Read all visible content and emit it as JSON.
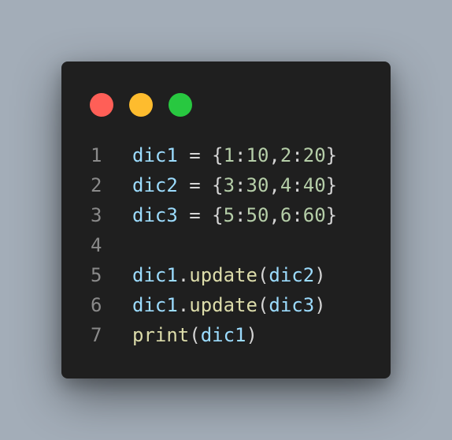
{
  "window": {
    "controls": [
      {
        "name": "close",
        "color": "#ff5f57"
      },
      {
        "name": "minimize",
        "color": "#febc2e"
      },
      {
        "name": "maximize",
        "color": "#28c840"
      }
    ]
  },
  "colors": {
    "background": "#a3adb8",
    "editor_background": "#1f1f1f",
    "line_number": "#8a8a8a",
    "variable": "#9cdcfe",
    "function": "#dcdcaa",
    "number": "#b5cea8",
    "punctuation": "#d4d4d4"
  },
  "code": {
    "lines": [
      {
        "number": "1",
        "tokens": [
          {
            "text": "dic1",
            "type": "var"
          },
          {
            "text": " = {",
            "type": "op"
          },
          {
            "text": "1",
            "type": "num"
          },
          {
            "text": ":",
            "type": "op"
          },
          {
            "text": "10",
            "type": "num"
          },
          {
            "text": ",",
            "type": "op"
          },
          {
            "text": "2",
            "type": "num"
          },
          {
            "text": ":",
            "type": "op"
          },
          {
            "text": "20",
            "type": "num"
          },
          {
            "text": "}",
            "type": "op"
          }
        ]
      },
      {
        "number": "2",
        "tokens": [
          {
            "text": "dic2",
            "type": "var"
          },
          {
            "text": " = {",
            "type": "op"
          },
          {
            "text": "3",
            "type": "num"
          },
          {
            "text": ":",
            "type": "op"
          },
          {
            "text": "30",
            "type": "num"
          },
          {
            "text": ",",
            "type": "op"
          },
          {
            "text": "4",
            "type": "num"
          },
          {
            "text": ":",
            "type": "op"
          },
          {
            "text": "40",
            "type": "num"
          },
          {
            "text": "}",
            "type": "op"
          }
        ]
      },
      {
        "number": "3",
        "tokens": [
          {
            "text": "dic3",
            "type": "var"
          },
          {
            "text": " = {",
            "type": "op"
          },
          {
            "text": "5",
            "type": "num"
          },
          {
            "text": ":",
            "type": "op"
          },
          {
            "text": "50",
            "type": "num"
          },
          {
            "text": ",",
            "type": "op"
          },
          {
            "text": "6",
            "type": "num"
          },
          {
            "text": ":",
            "type": "op"
          },
          {
            "text": "60",
            "type": "num"
          },
          {
            "text": "}",
            "type": "op"
          }
        ]
      },
      {
        "number": "4",
        "tokens": []
      },
      {
        "number": "5",
        "tokens": [
          {
            "text": "dic1",
            "type": "var"
          },
          {
            "text": ".",
            "type": "op"
          },
          {
            "text": "update",
            "type": "fn"
          },
          {
            "text": "(",
            "type": "op"
          },
          {
            "text": "dic2",
            "type": "var"
          },
          {
            "text": ")",
            "type": "op"
          }
        ]
      },
      {
        "number": "6",
        "tokens": [
          {
            "text": "dic1",
            "type": "var"
          },
          {
            "text": ".",
            "type": "op"
          },
          {
            "text": "update",
            "type": "fn"
          },
          {
            "text": "(",
            "type": "op"
          },
          {
            "text": "dic3",
            "type": "var"
          },
          {
            "text": ")",
            "type": "op"
          }
        ]
      },
      {
        "number": "7",
        "tokens": [
          {
            "text": "print",
            "type": "fn"
          },
          {
            "text": "(",
            "type": "op"
          },
          {
            "text": "dic1",
            "type": "var"
          },
          {
            "text": ")",
            "type": "op"
          }
        ]
      }
    ]
  }
}
